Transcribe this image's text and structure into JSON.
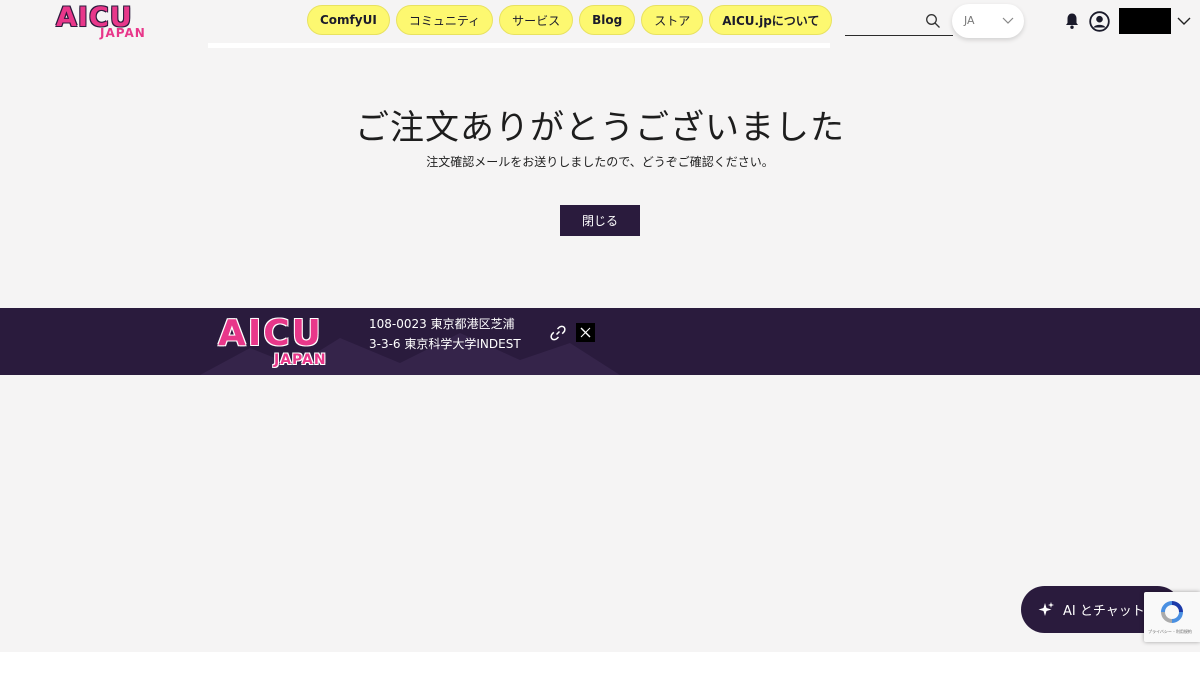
{
  "header": {
    "logo": {
      "top": "AICU",
      "bottom": "JAPAN"
    },
    "nav": [
      {
        "label": "ComfyUI"
      },
      {
        "label": "コミュニティ"
      },
      {
        "label": "サービス"
      },
      {
        "label": "Blog"
      },
      {
        "label": "ストア"
      },
      {
        "label": "AICU.jpについて"
      }
    ],
    "search": {
      "placeholder": ""
    },
    "language": {
      "selected": "JA"
    }
  },
  "main": {
    "title": "ご注文ありがとうございました",
    "subtitle": "注文確認メールをお送りしましたので、どうぞご確認ください。",
    "close_label": "閉じる"
  },
  "footer": {
    "logo": {
      "top": "AICU",
      "bottom": "JAPAN"
    },
    "address_line1": "108-0023 東京都港区芝浦",
    "address_line2": "3-3-6 東京科学大学INDEST"
  },
  "chat": {
    "label": "AI とチャット"
  },
  "recaptcha": {
    "text": "プライバシー - 利用規約"
  },
  "colors": {
    "nav_pill": "#fdf870",
    "brand_dark": "#2a1b3d",
    "brand_pink": "#e8378a",
    "page_bg": "#f5f4f4"
  },
  "icons": [
    "search-icon",
    "chevron-down-icon",
    "bell-icon",
    "avatar-icon",
    "link-icon",
    "x-logo-icon",
    "sparkle-icon",
    "recaptcha-icon"
  ]
}
